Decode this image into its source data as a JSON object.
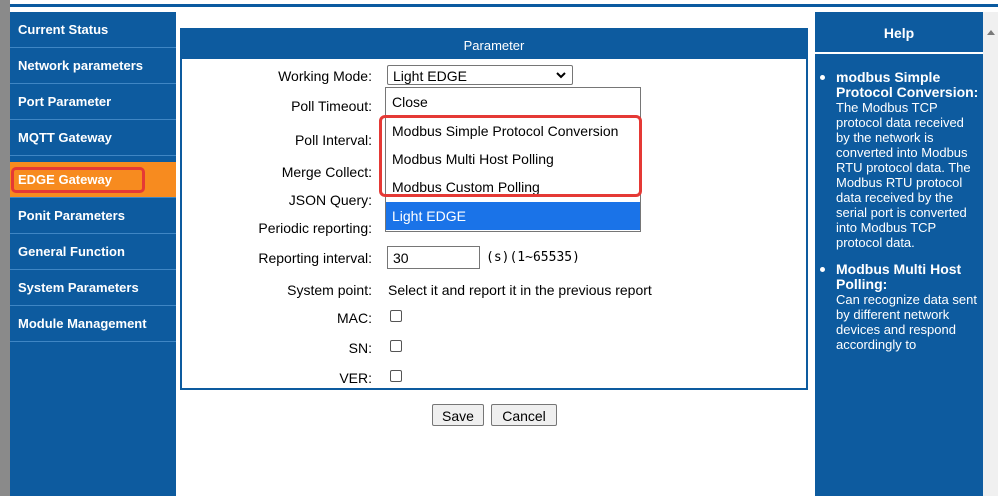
{
  "sidebar": {
    "items": [
      {
        "label": "Current Status"
      },
      {
        "label": "Network parameters"
      },
      {
        "label": "Port Parameter"
      },
      {
        "label": "MQTT Gateway"
      },
      {
        "label": "EDGE Gateway"
      },
      {
        "label": "Ponit Parameters"
      },
      {
        "label": "General Function"
      },
      {
        "label": "System Parameters"
      },
      {
        "label": "Module Management"
      }
    ],
    "active": "EDGE Gateway"
  },
  "panel": {
    "title": "Parameter",
    "working_mode_label": "Working Mode:",
    "working_mode_value": "Light EDGE",
    "poll_timeout_label": "Poll Timeout:",
    "poll_interval_label": "Poll Interval:",
    "merge_collect_label": "Merge Collect:",
    "json_query_label": "JSON Query:",
    "periodic_reporting_label": "Periodic reporting:",
    "reporting_interval_label": "Reporting interval:",
    "reporting_interval_value": "30",
    "reporting_interval_unit": "(s)(1~65535)",
    "system_point_label": "System point:",
    "system_point_text": "Select it and report it in the previous report",
    "mac_label": "MAC:",
    "sn_label": "SN:",
    "ver_label": "VER:"
  },
  "dropdown": {
    "options": [
      "Close",
      "Modbus Simple Protocol Conversion",
      "Modbus Multi Host Polling",
      "Modbus Custom Polling",
      "Light EDGE"
    ],
    "selected": "Light EDGE"
  },
  "buttons": {
    "save": "Save",
    "cancel": "Cancel"
  },
  "help": {
    "title": "Help",
    "items": [
      {
        "title": "modbus Simple Protocol Conversion:",
        "body": "The Modbus TCP protocol data received by the network is converted into Modbus RTU protocol data. The Modbus RTU protocol data received by the serial port is converted into Modbus TCP protocol data."
      },
      {
        "title": "Modbus Multi Host Polling:",
        "body": "Can recognize data sent by different network devices and respond accordingly to"
      }
    ]
  },
  "colors": {
    "primary_blue": "#0d5b9f",
    "active_orange": "#f78b1f",
    "highlight_red": "#e53935",
    "selected_blue": "#1a73e8"
  }
}
